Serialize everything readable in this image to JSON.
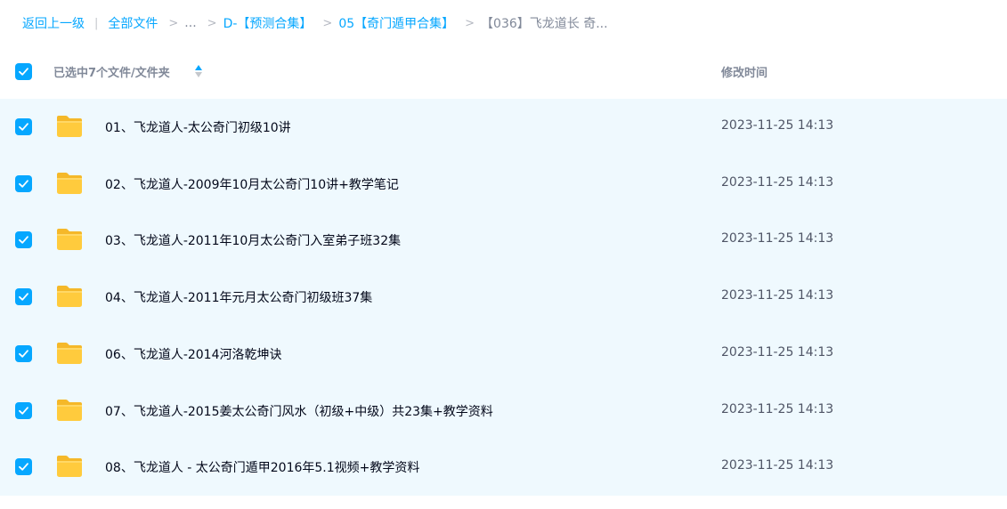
{
  "breadcrumb": {
    "back": "返回上一级",
    "all_files": "全部文件",
    "ellipsis": "...",
    "crumb1": "D-【预测合集】",
    "crumb2": "05【奇门遁甲合集】",
    "current": "【036】飞龙道长 奇..."
  },
  "header": {
    "selection_label": "已选中7个文件/文件夹",
    "modified_time_label": "修改时间"
  },
  "colors": {
    "accent": "#06a7ff",
    "selected_row_bg": "#eff9fe",
    "folder": "#ffc93c"
  },
  "files": [
    {
      "name": "01、飞龙道人-太公奇门初级10讲",
      "time": "2023-11-25 14:13",
      "icon": "folder-icon",
      "checked": true
    },
    {
      "name": "02、飞龙道人-2009年10月太公奇门10讲+教学笔记",
      "time": "2023-11-25 14:13",
      "icon": "folder-icon",
      "checked": true
    },
    {
      "name": "03、飞龙道人-2011年10月太公奇门入室弟子班32集",
      "time": "2023-11-25 14:13",
      "icon": "folder-icon",
      "checked": true
    },
    {
      "name": "04、飞龙道人-2011年元月太公奇门初级班37集",
      "time": "2023-11-25 14:13",
      "icon": "folder-icon",
      "checked": true
    },
    {
      "name": "06、飞龙道人-2014河洛乾坤诀",
      "time": "2023-11-25 14:13",
      "icon": "folder-icon",
      "checked": true
    },
    {
      "name": "07、飞龙道人-2015姜太公奇门风水（初级+中级）共23集+教学资料",
      "time": "2023-11-25 14:13",
      "icon": "folder-icon",
      "checked": true
    },
    {
      "name": "08、飞龙道人 - 太公奇门遁甲2016年5.1视频+教学资料",
      "time": "2023-11-25 14:13",
      "icon": "folder-icon",
      "checked": true
    }
  ]
}
